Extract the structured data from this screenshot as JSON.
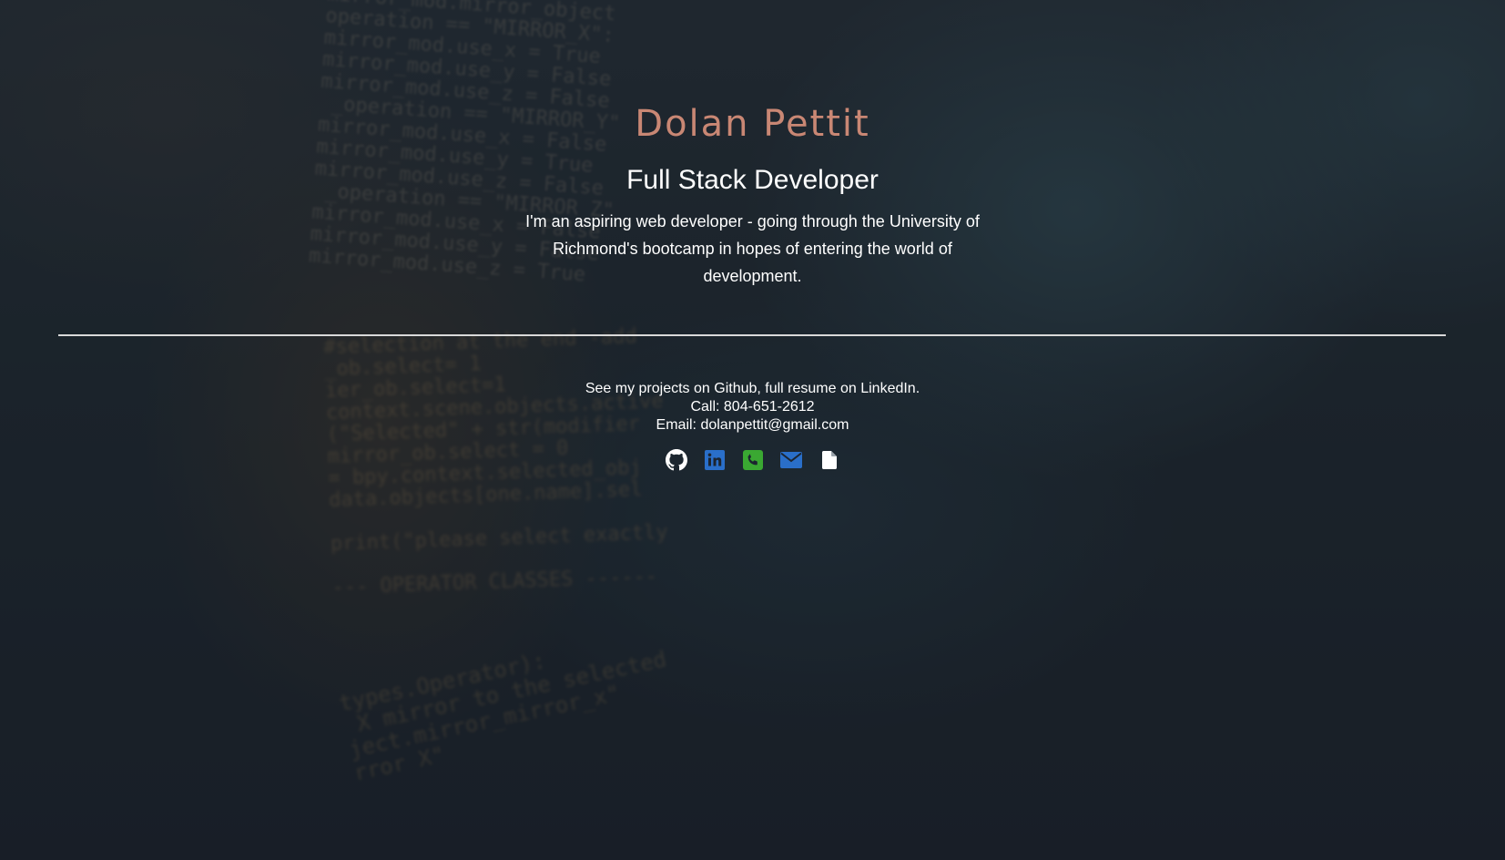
{
  "hero": {
    "name": "Dolan Pettit",
    "role": "Full Stack Developer",
    "intro": "I'm an aspiring web developer - going through the University of Richmond's bootcamp in hopes of entering the world of development."
  },
  "footer": {
    "projects_line": "See my projects on Github, full resume on LinkedIn.",
    "call_line": "Call: 804-651-2612",
    "email_line": "Email: dolanpettit@gmail.com"
  },
  "icons": [
    {
      "name": "github-icon",
      "color": "#ffffff"
    },
    {
      "name": "linkedin-icon",
      "color": "#2a6fc9"
    },
    {
      "name": "phone-icon",
      "color": "#3aa832"
    },
    {
      "name": "email-icon",
      "color": "#2a6fc9"
    },
    {
      "name": "resume-file-icon",
      "color": "#ffffff"
    }
  ],
  "colors": {
    "name_accent": "#c98774",
    "divider": "#d9d9d9",
    "background": "#1c2530"
  }
}
